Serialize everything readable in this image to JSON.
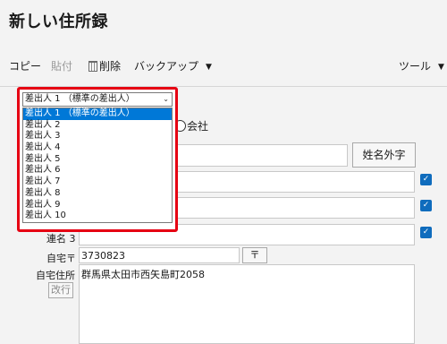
{
  "app": {
    "title": "新しい住所録"
  },
  "toolbar": {
    "copy": "コピー",
    "paste": "貼付",
    "delete": "削除",
    "backup": "バックアップ",
    "tools": "ツール",
    "caret": "▼"
  },
  "sender_dropdown": {
    "selected": "差出人 1 （標準の差出人）",
    "options": [
      "差出人 1 （標準の差出人）",
      "差出人 2",
      "差出人 3",
      "差出人 4",
      "差出人 5",
      "差出人 6",
      "差出人 7",
      "差出人 8",
      "差出人 9",
      "差出人 10"
    ],
    "selected_index": 0
  },
  "form": {
    "type_radio_label": "会社",
    "sei_mei_button": "姓名外字",
    "rengo3_label": "連名 3",
    "postal_label": "自宅〒",
    "postal_value": "3730823",
    "postal_button": "〒",
    "address_label": "自宅住所",
    "address_value": "群馬県太田市西矢島町2058",
    "newline_button": "改行",
    "checkmark": "✓"
  },
  "colors": {
    "accent": "#0f6cbd",
    "highlight_border": "#e60012",
    "selected_row": "#0078d7"
  }
}
